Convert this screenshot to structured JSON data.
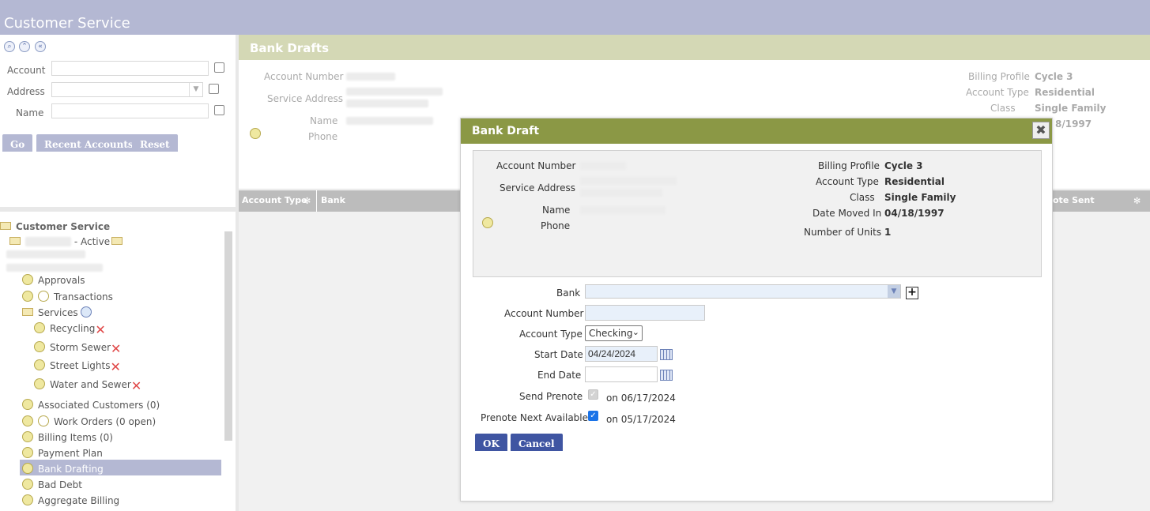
{
  "app": {
    "title": "Customer Service"
  },
  "search": {
    "fields": [
      {
        "label": "Account",
        "value": ""
      },
      {
        "label": "Address",
        "value": ""
      },
      {
        "label": "Name",
        "value": ""
      }
    ],
    "buttons": {
      "go": "Go",
      "recent": "Recent Accounts",
      "reset": "Reset"
    }
  },
  "tree": {
    "root": "Customer Service",
    "account_suffix": "- Active",
    "items": {
      "approvals": "Approvals",
      "transactions": "Transactions",
      "services": "Services",
      "recycling": "Recycling",
      "storm_sewer": "Storm Sewer",
      "street_lights": "Street Lights",
      "water_sewer": "Water and Sewer",
      "associated": "Associated Customers (0)",
      "work_orders": "Work Orders (0 open)",
      "billing_items": "Billing Items (0)",
      "payment_plan": "Payment Plan",
      "bank_drafting": "Bank Drafting",
      "bad_debt": "Bad Debt",
      "aggregate": "Aggregate Billing"
    },
    "removed_glyph": "✕"
  },
  "main": {
    "title": "Bank Drafts",
    "summary": {
      "account_number_label": "Account Number",
      "service_address_label": "Service Address",
      "name_label": "Name",
      "phone_label": "Phone",
      "billing_profile_label": "Billing Profile",
      "billing_profile": "Cycle 3",
      "account_type_label": "Account Type",
      "account_type": "Residential",
      "class_label": "Class",
      "class": "Single Family",
      "date_partial": "8/1997"
    },
    "grid_headers": {
      "account_type": "Account Type",
      "bank": "Bank",
      "prenote_sent": "ote Sent"
    }
  },
  "modal": {
    "title": "Bank Draft",
    "close_glyph": "✖",
    "summary": {
      "account_number_label": "Account Number",
      "service_address_label": "Service Address",
      "name_label": "Name",
      "phone_label": "Phone",
      "billing_profile_label": "Billing Profile",
      "billing_profile": "Cycle 3",
      "account_type_label": "Account Type",
      "account_type": "Residential",
      "class_label": "Class",
      "class": "Single Family",
      "date_moved_in_label": "Date Moved In",
      "date_moved_in": "04/18/1997",
      "number_of_units_label": "Number of Units",
      "number_of_units": "1"
    },
    "form": {
      "bank_label": "Bank",
      "bank_value": "",
      "account_number_label": "Account Number",
      "account_number_value": "",
      "account_type_label": "Account Type",
      "account_type_value": "Checking",
      "start_date_label": "Start Date",
      "start_date_value": "04/24/2024",
      "end_date_label": "End Date",
      "end_date_value": "",
      "send_prenote_label": "Send Prenote",
      "send_prenote_text": "on 06/17/2024",
      "prenote_next_label": "Prenote Next Available",
      "prenote_next_text": "on 05/17/2024",
      "ok": "OK",
      "cancel": "Cancel"
    }
  }
}
